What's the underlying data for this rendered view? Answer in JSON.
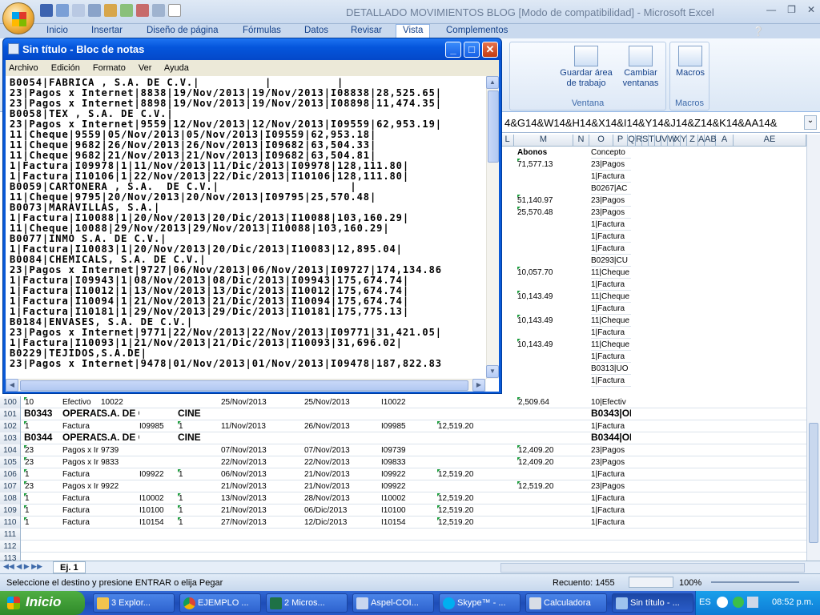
{
  "excel": {
    "title": "DETALLADO MOVIMIENTOS BLOG  [Modo de compatibilidad] - Microsoft Excel",
    "tabs": [
      "Inicio",
      "Insertar",
      "Diseño de página",
      "Fórmulas",
      "Datos",
      "Revisar",
      "Vista",
      "Complementos"
    ],
    "active_tab": "Vista",
    "ribbon": {
      "guardar_area": "Guardar área de trabajo",
      "cambiar_ventanas": "Cambiar ventanas",
      "macros": "Macros",
      "group_ventana": "Ventana",
      "group_macros": "Macros"
    },
    "formula_text": "4&G14&W14&H14&X14&I14&Y14&J14&Z14&K14&AA14&",
    "columns": [
      "L",
      "M",
      "N",
      "O",
      "P",
      "Q",
      "R",
      "S",
      "T",
      "U",
      "V",
      "W",
      "X",
      "Y",
      "Z",
      "A",
      "AB",
      "A",
      "AE"
    ],
    "right_rows": [
      [
        "Abonos",
        "Concepto"
      ],
      [
        "71,577.13",
        "23|Pagos"
      ],
      [
        "",
        "1|Factura"
      ],
      [
        "",
        "B0267|AC"
      ],
      [
        "51,140.97",
        "23|Pagos"
      ],
      [
        "25,570.48",
        "23|Pagos"
      ],
      [
        "",
        "1|Factura"
      ],
      [
        "",
        "1|Factura"
      ],
      [
        "",
        "1|Factura"
      ],
      [
        "",
        "B0293|CU"
      ],
      [
        "10,057.70",
        "11|Cheque"
      ],
      [
        "",
        "1|Factura"
      ],
      [
        "10,143.49",
        "11|Cheque"
      ],
      [
        "",
        "1|Factura"
      ],
      [
        "10,143.49",
        "11|Cheque"
      ],
      [
        "",
        "1|Factura"
      ],
      [
        "10,143.49",
        "11|Cheque"
      ],
      [
        "",
        "1|Factura"
      ],
      [
        "",
        "B0313|UO"
      ],
      [
        "",
        "1|Factura"
      ]
    ],
    "rows": [
      {
        "n": "100",
        "cells": [
          "10",
          "Efectivo",
          "10022",
          "",
          "",
          "25/Nov/2013",
          "25/Nov/2013",
          "I10022",
          "",
          "2,509.64",
          "10|Efectiv"
        ]
      },
      {
        "n": "101",
        "bold": true,
        "cells": [
          "B0343",
          "OPERADORA",
          "S.A. DE C.V.",
          "",
          "CINE",
          "",
          "",
          "",
          "",
          "",
          "B0343|OP"
        ]
      },
      {
        "n": "102",
        "cells": [
          "1",
          "Factura",
          "",
          "I09985",
          "1",
          "11/Nov/2013",
          "26/Nov/2013",
          "I09985",
          "12,519.20",
          "",
          "1|Factura"
        ]
      },
      {
        "n": "103",
        "bold": true,
        "cells": [
          "B0344",
          "OPERADORA",
          "S.A. DE C.V.",
          "",
          "CINE",
          "",
          "",
          "",
          "",
          "",
          "B0344|OP"
        ]
      },
      {
        "n": "104",
        "cells": [
          "23",
          "Pagos x Ir",
          "9739",
          "",
          "",
          "07/Nov/2013",
          "07/Nov/2013",
          "I09739",
          "",
          "12,409.20",
          "23|Pagos"
        ]
      },
      {
        "n": "105",
        "cells": [
          "23",
          "Pagos x Ir",
          "9833",
          "",
          "",
          "22/Nov/2013",
          "22/Nov/2013",
          "I09833",
          "",
          "12,409.20",
          "23|Pagos"
        ]
      },
      {
        "n": "106",
        "cells": [
          "1",
          "Factura",
          "",
          "I09922",
          "1",
          "06/Nov/2013",
          "21/Nov/2013",
          "I09922",
          "12,519.20",
          "",
          "1|Factura"
        ]
      },
      {
        "n": "107",
        "cells": [
          "23",
          "Pagos x Ir",
          "9922",
          "",
          "",
          "21/Nov/2013",
          "21/Nov/2013",
          "I09922",
          "",
          "12,519.20",
          "23|Pagos"
        ]
      },
      {
        "n": "108",
        "cells": [
          "1",
          "Factura",
          "",
          "I10002",
          "1",
          "13/Nov/2013",
          "28/Nov/2013",
          "I10002",
          "12,519.20",
          "",
          "1|Factura"
        ]
      },
      {
        "n": "109",
        "cells": [
          "1",
          "Factura",
          "",
          "I10100",
          "1",
          "21/Nov/2013",
          "06/Dic/2013",
          "I10100",
          "12,519.20",
          "",
          "1|Factura"
        ]
      },
      {
        "n": "110",
        "cells": [
          "1",
          "Factura",
          "",
          "I10154",
          "1",
          "27/Nov/2013",
          "12/Dic/2013",
          "I10154",
          "12,519.20",
          "",
          "1|Factura"
        ]
      },
      {
        "n": "111",
        "cells": [
          "",
          "",
          "",
          "",
          "",
          "",
          "",
          "",
          "",
          "",
          ""
        ]
      },
      {
        "n": "112",
        "cells": [
          "",
          "",
          "",
          "",
          "",
          "",
          "",
          "",
          "",
          "",
          ""
        ]
      },
      {
        "n": "113",
        "cells": [
          "",
          "",
          "",
          "",
          "",
          "",
          "",
          "",
          "",
          "",
          ""
        ]
      }
    ],
    "sheet_tab": "Ej. 1",
    "status_left": "Seleccione el destino y presione ENTRAR o elija Pegar",
    "status_count": "Recuento: 1455",
    "zoom": "100%"
  },
  "notepad": {
    "title": "Sin título - Bloc de notas",
    "menu": [
      "Archivo",
      "Edición",
      "Formato",
      "Ver",
      "Ayuda"
    ],
    "lines": [
      "B0054|FABRICA , S.A. DE C.V.|          |          |",
      "23|Pagos x Internet|8838|19/Nov/2013|19/Nov/2013|I08838|28,525.65|",
      "23|Pagos x Internet|8898|19/Nov/2013|19/Nov/2013|I08898|11,474.35|",
      "B0058|TEX , S.A. DE C.V.|",
      "23|Pagos x Internet|9559|12/Nov/2013|12/Nov/2013|I09559|62,953.19|",
      "11|Cheque|9559|05/Nov/2013|05/Nov/2013|I09559|62,953.18|",
      "11|Cheque|9682|26/Nov/2013|26/Nov/2013|I09682|63,504.33|",
      "11|Cheque|9682|21/Nov/2013|21/Nov/2013|I09682|63,504.81|",
      "1|Factura|I09978|1|11/Nov/2013|11/Dic/2013|I09978|128,111.80|",
      "1|Factura|I10106|1|22/Nov/2013|22/Dic/2013|I10106|128,111.80|",
      "B0059|CARTONERA , S.A.  DE C.V.|                    |",
      "11|Cheque|9795|20/Nov/2013|20/Nov/2013|I09795|25,570.48|",
      "B0073|MARAVILLAS, S.A.|",
      "1|Factura|I10088|1|20/Nov/2013|20/Dic/2013|I10088|103,160.29|",
      "11|Cheque|10088|29/Nov/2013|29/Nov/2013|I10088|103,160.29|",
      "B0077|INMO S.A. DE C.V.|",
      "1|Factura|I10083|1|20/Nov/2013|20/Dic/2013|I10083|12,895.04|",
      "B0084|CHEMICALS, S.A. DE C.V.|",
      "23|Pagos x Internet|9727|06/Nov/2013|06/Nov/2013|I09727|174,134.86",
      "1|Factura|I09943|1|08/Nov/2013|08/Dic/2013|I09943|175,674.74|",
      "1|Factura|I10012|1|13/Nov/2013|13/Dic/2013|I10012|175,674.74|",
      "1|Factura|I10094|1|21/Nov/2013|21/Dic/2013|I10094|175,674.74|",
      "1|Factura|I10181|1|29/Nov/2013|29/Dic/2013|I10181|175,775.13|",
      "B0184|ENVASES, S.A. DE C.V.|",
      "23|Pagos x Internet|9771|22/Nov/2013|22/Nov/2013|I09771|31,421.05|",
      "1|Factura|I10093|1|21/Nov/2013|21/Dic/2013|I10093|31,696.02|",
      "B0229|TEJIDOS,S.A.DE|",
      "23|Pagos x Internet|9478|01/Nov/2013|01/Nov/2013|I09478|187,822.83"
    ]
  },
  "taskbar": {
    "start": "Inicio",
    "items": [
      "3 Explor...",
      "EJEMPLO ...",
      "2 Micros...",
      "Aspel-COI...",
      "Skype™ - ...",
      "Calculadora",
      "Sin título - ..."
    ],
    "lang": "ES",
    "clock": "08:52 p.m."
  }
}
